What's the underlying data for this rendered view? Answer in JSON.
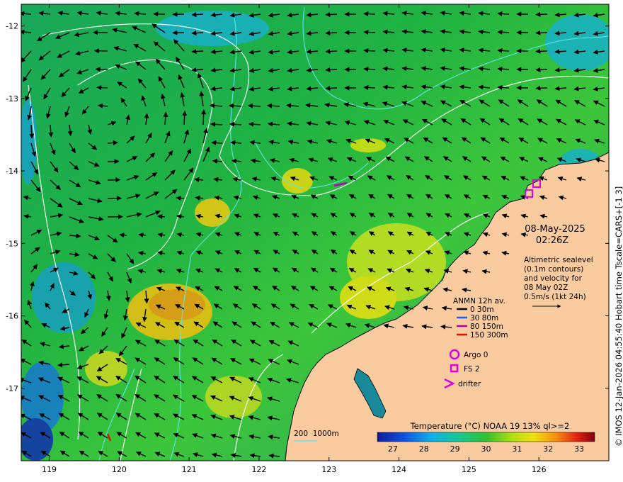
{
  "map": {
    "x_ticks": [
      "119",
      "120",
      "121",
      "122",
      "123",
      "124",
      "125",
      "126"
    ],
    "y_ticks": [
      "-12",
      "-13",
      "-14",
      "-15",
      "-16",
      "-17"
    ],
    "x_range": [
      118.6,
      127.0
    ],
    "y_range": [
      -11.7,
      -18.0
    ]
  },
  "date_line": "08-May-2025",
  "time_line": "02:26Z",
  "altimetry_note": [
    "Altimetric sealevel",
    "(0.1m contours)",
    "and velocity for",
    "08 May 02Z",
    "0.5m/s (1kt 24h)"
  ],
  "legend": {
    "title": "ANMN 12h av.",
    "entries": [
      {
        "label": "0 30m",
        "color": "#000000"
      },
      {
        "label": "30 80m",
        "color": "#1a5cff"
      },
      {
        "label": "80 150m",
        "color": "#b000b0"
      },
      {
        "label": "150 300m",
        "color": "#e01000"
      }
    ]
  },
  "platforms": [
    {
      "label": "Argo 0",
      "marker": "circle-icon",
      "color": "#e000e0"
    },
    {
      "label": "FS 2",
      "marker": "square-icon",
      "color": "#e000e0"
    },
    {
      "label": "drifter",
      "marker": "chevron-icon",
      "color": "#e000e0"
    }
  ],
  "bathymetry_label": "200  1000m",
  "colorbar": {
    "title": "Temperature (°C) NOAA 19 13% ql>=2",
    "ticks": [
      "27",
      "28",
      "29",
      "30",
      "31",
      "32",
      "33"
    ]
  },
  "credit": "© IMOS 12-Jan-2026 04:55:40 Hobart time Tscale=CARS+[-1 3]",
  "colors": {
    "land": "#fbcba0",
    "coast": "#000000",
    "sealevel_contour": "#ffffff",
    "bathymetry_contour": "#5fe6e6",
    "arrow": "#000000"
  }
}
